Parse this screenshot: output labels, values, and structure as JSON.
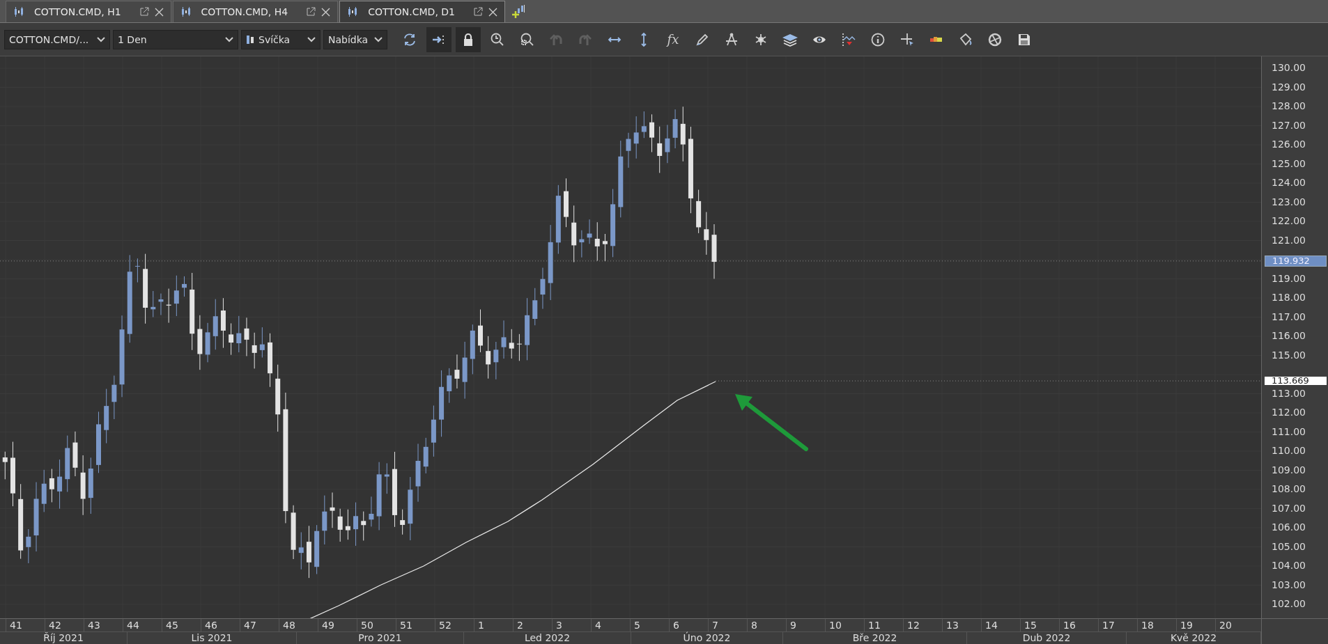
{
  "tabs": [
    {
      "label": "COTTON.CMD, H1",
      "selected": false
    },
    {
      "label": "COTTON.CMD, H4",
      "selected": false
    },
    {
      "label": "COTTON.CMD, D1",
      "selected": true
    }
  ],
  "toolbar": {
    "instrument": "COTTON.CMD/...",
    "period": "1 Den",
    "chart_type": "Svíčka",
    "price_side": "Nabídka",
    "tools": [
      {
        "kind": "refresh",
        "pressed": false,
        "disabled": false
      },
      {
        "kind": "shift",
        "pressed": true,
        "disabled": false
      },
      {
        "kind": "lock",
        "pressed": true,
        "disabled": false
      },
      {
        "kind": "zoom-time",
        "pressed": false,
        "disabled": false
      },
      {
        "kind": "zoom-area",
        "pressed": false,
        "disabled": false
      },
      {
        "kind": "undo",
        "pressed": false,
        "disabled": true
      },
      {
        "kind": "redo",
        "pressed": false,
        "disabled": true
      },
      {
        "kind": "hstretch",
        "pressed": false,
        "disabled": false
      },
      {
        "kind": "vstretch",
        "pressed": false,
        "disabled": false
      },
      {
        "kind": "formula",
        "label": "fx",
        "pressed": false,
        "disabled": false
      },
      {
        "kind": "pencil",
        "pressed": false,
        "disabled": false
      },
      {
        "kind": "compass",
        "pressed": false,
        "disabled": false
      },
      {
        "kind": "nodes",
        "pressed": false,
        "disabled": false
      },
      {
        "kind": "layers",
        "pressed": false,
        "disabled": false
      },
      {
        "kind": "eye",
        "pressed": false,
        "disabled": false
      },
      {
        "kind": "alert",
        "pressed": false,
        "disabled": false
      },
      {
        "kind": "info",
        "pressed": false,
        "disabled": false
      },
      {
        "kind": "crosshair",
        "pressed": false,
        "disabled": false
      },
      {
        "kind": "colorbar",
        "pressed": false,
        "disabled": false
      },
      {
        "kind": "bucket",
        "pressed": false,
        "disabled": false
      },
      {
        "kind": "aperture",
        "pressed": false,
        "disabled": false
      },
      {
        "kind": "save",
        "pressed": false,
        "disabled": false
      }
    ]
  },
  "chart": {
    "price_labels": [
      "130.00",
      "129.00",
      "128.00",
      "127.00",
      "126.00",
      "125.00",
      "124.00",
      "123.00",
      "122.00",
      "121.00",
      "119.00",
      "118.00",
      "117.00",
      "116.00",
      "115.00",
      "113.00",
      "112.00",
      "111.00",
      "110.00",
      "109.00",
      "108.00",
      "107.00",
      "106.00",
      "105.00",
      "104.00",
      "103.00",
      "102.00"
    ],
    "current_price": "119.932",
    "average_price": "113.669",
    "week_labels": [
      "41",
      "42",
      "43",
      "44",
      "45",
      "46",
      "47",
      "48",
      "49",
      "50",
      "51",
      "52",
      "1",
      "2",
      "3",
      "4",
      "5",
      "6",
      "7",
      "8",
      "9",
      "10",
      "11",
      "12",
      "13",
      "14",
      "15",
      "16",
      "17",
      "18",
      "19",
      "20"
    ],
    "month_labels": [
      "Říj 2021",
      "Lis 2021",
      "Pro 2021",
      "Led 2022",
      "Úno 2022",
      "Bře 2022",
      "Dub 2022",
      "Kvě 2022"
    ]
  }
}
